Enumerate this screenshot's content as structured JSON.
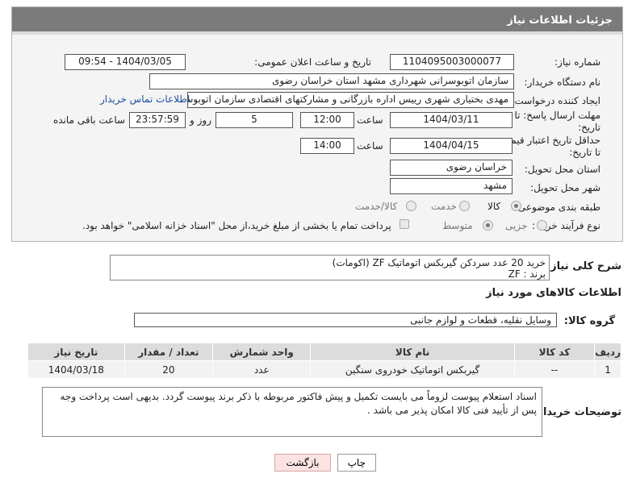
{
  "header": {
    "title": "جزئیات اطلاعات نیاز"
  },
  "fields": {
    "need_number_label": "شماره نیاز:",
    "need_number": "1104095003000077",
    "announce_label": "تاریخ و ساعت اعلان عمومی:",
    "announce_value": "1404/03/05 - 09:54",
    "buyer_org_label": "نام دستگاه خریدار:",
    "buyer_org": "سازمان اتوبوسرانی شهرداری مشهد استان خراسان رضوی",
    "creator_label": "ایجاد کننده درخواست:",
    "creator": "مهدی بختیاری شهری رییس اداره بازرگانی و مشارکتهای اقتصادی سازمان اتوبوس",
    "contact_link": "اطلاعات تماس خریدار",
    "reply_deadline_label_1": "مهلت ارسال پاسخ: تا",
    "reply_deadline_label_2": "تاریخ:",
    "reply_date": "1404/03/11",
    "time_label": "ساعت",
    "reply_time": "12:00",
    "days_value": "5",
    "days_label": "روز و",
    "remaining_time": "23:57:59",
    "remaining_label": "ساعت باقی مانده",
    "price_validity_label_1": "حداقل تاریخ اعتبار قیمت:",
    "price_validity_label_2": "تا تاریخ:",
    "price_date": "1404/04/15",
    "price_time": "14:00",
    "province_label": "استان محل تحویل:",
    "province": "خراسان رضوی",
    "city_label": "شهر محل تحویل:",
    "city": "مشهد",
    "category_label": "طبقه بندی موضوعی:",
    "category_options": [
      "کالا",
      "خدمت",
      "کالا/خدمت"
    ],
    "process_label": "نوع فرآیند خرید :",
    "process_options": [
      "جزیی",
      "متوسط"
    ],
    "payment_note": "پرداخت تمام یا بخشی از مبلغ خرید،از محل \"اسناد خزانه اسلامی\" خواهد بود."
  },
  "description": {
    "label": "شرح کلی نیاز:",
    "line1": "خرید 20 عدد سردکن گیربکس اتوماتیک ZF (اکومات)",
    "line2": "برند : ZF"
  },
  "goods": {
    "section_title": "اطلاعات کالاهای مورد نیاز",
    "group_label": "گروه کالا:",
    "group_value": "وسایل نقلیه، قطعات و لوازم جانبی",
    "columns": [
      "ردیف",
      "کد کالا",
      "نام کالا",
      "واحد شمارش",
      "تعداد / مقدار",
      "تاریخ نیاز"
    ],
    "rows": [
      {
        "row": "1",
        "code": "--",
        "name": "گیربکس اتوماتیک خودروی سنگین",
        "unit": "عدد",
        "qty": "20",
        "date": "1404/03/18"
      }
    ]
  },
  "buyer_notes": {
    "label": "توضیحات خریدار:",
    "text": "اسناد استعلام پیوست لزوماً می بایست تکمیل و پیش فاکتور مربوطه با ذکر برند پیوست گردد. بدیهی است پرداخت وجه پس از تأیید فنی کالا امکان پذیر می باشد ."
  },
  "buttons": {
    "print": "چاپ",
    "back": "بازگشت"
  }
}
